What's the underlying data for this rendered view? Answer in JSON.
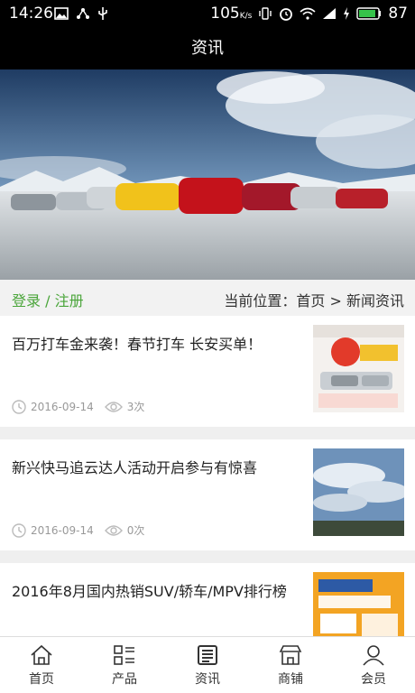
{
  "status": {
    "time": "14:26",
    "network_speed": "105",
    "speed_unit": "K/s",
    "battery": "87"
  },
  "header": {
    "title": "资讯"
  },
  "subheader": {
    "login_register": "登录 / 注册",
    "breadcrumb": "当前位置：首页 > 新闻资讯"
  },
  "news": [
    {
      "title": "百万打车金来袭！春节打车 长安买单！",
      "date": "2016-09-14",
      "views": "3次",
      "thumb_icon": "promo-poster"
    },
    {
      "title": "新兴快马追云达人活动开启参与有惊喜",
      "date": "2016-09-14",
      "views": "0次",
      "thumb_icon": "sky-clouds-photo"
    },
    {
      "title": "2016年8月国内热销SUV/轿车/MPV排行榜",
      "date": "",
      "views": "",
      "thumb_icon": "ranking-poster"
    }
  ],
  "tabs": [
    {
      "label": "首页",
      "icon": "home-icon"
    },
    {
      "label": "产品",
      "icon": "product-list-icon"
    },
    {
      "label": "资讯",
      "icon": "news-icon"
    },
    {
      "label": "商铺",
      "icon": "shop-icon"
    },
    {
      "label": "会员",
      "icon": "member-icon"
    }
  ],
  "colors": {
    "accent": "#4aa53a",
    "bar": "#000000"
  }
}
